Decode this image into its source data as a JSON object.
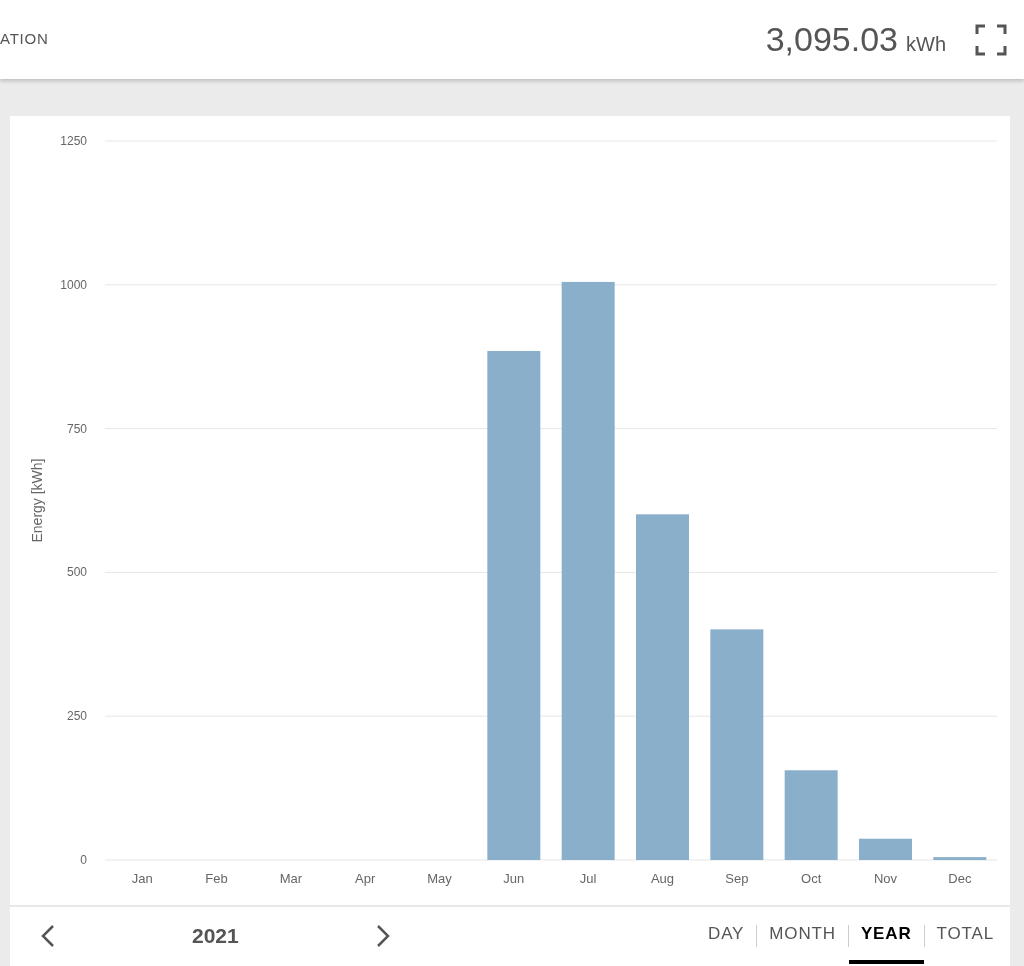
{
  "header": {
    "title": "ATION",
    "total": "3,095.03",
    "unit": "kWh"
  },
  "chart": {
    "chart_data": {
      "type": "bar",
      "ylabel": "Energy [kWh]",
      "categories": [
        "Jan",
        "Feb",
        "Mar",
        "Apr",
        "May",
        "Jun",
        "Jul",
        "Aug",
        "Sep",
        "Oct",
        "Nov",
        "Dec"
      ],
      "grid": true,
      "series": [
        {
          "color": "#8aafcb",
          "values": [
            0,
            0,
            0,
            0,
            0,
            885,
            1005,
            601,
            401,
            156,
            37,
            5
          ]
        }
      ],
      "ylim": [
        0,
        1250
      ],
      "yticks": [
        0,
        250,
        500,
        750,
        1000,
        1250
      ]
    }
  },
  "navigator": {
    "period": "2021"
  },
  "tabs": [
    {
      "label": "DAY",
      "selected": false
    },
    {
      "label": "MONTH",
      "selected": false
    },
    {
      "label": "YEAR",
      "selected": true
    },
    {
      "label": "TOTAL",
      "selected": false
    }
  ]
}
